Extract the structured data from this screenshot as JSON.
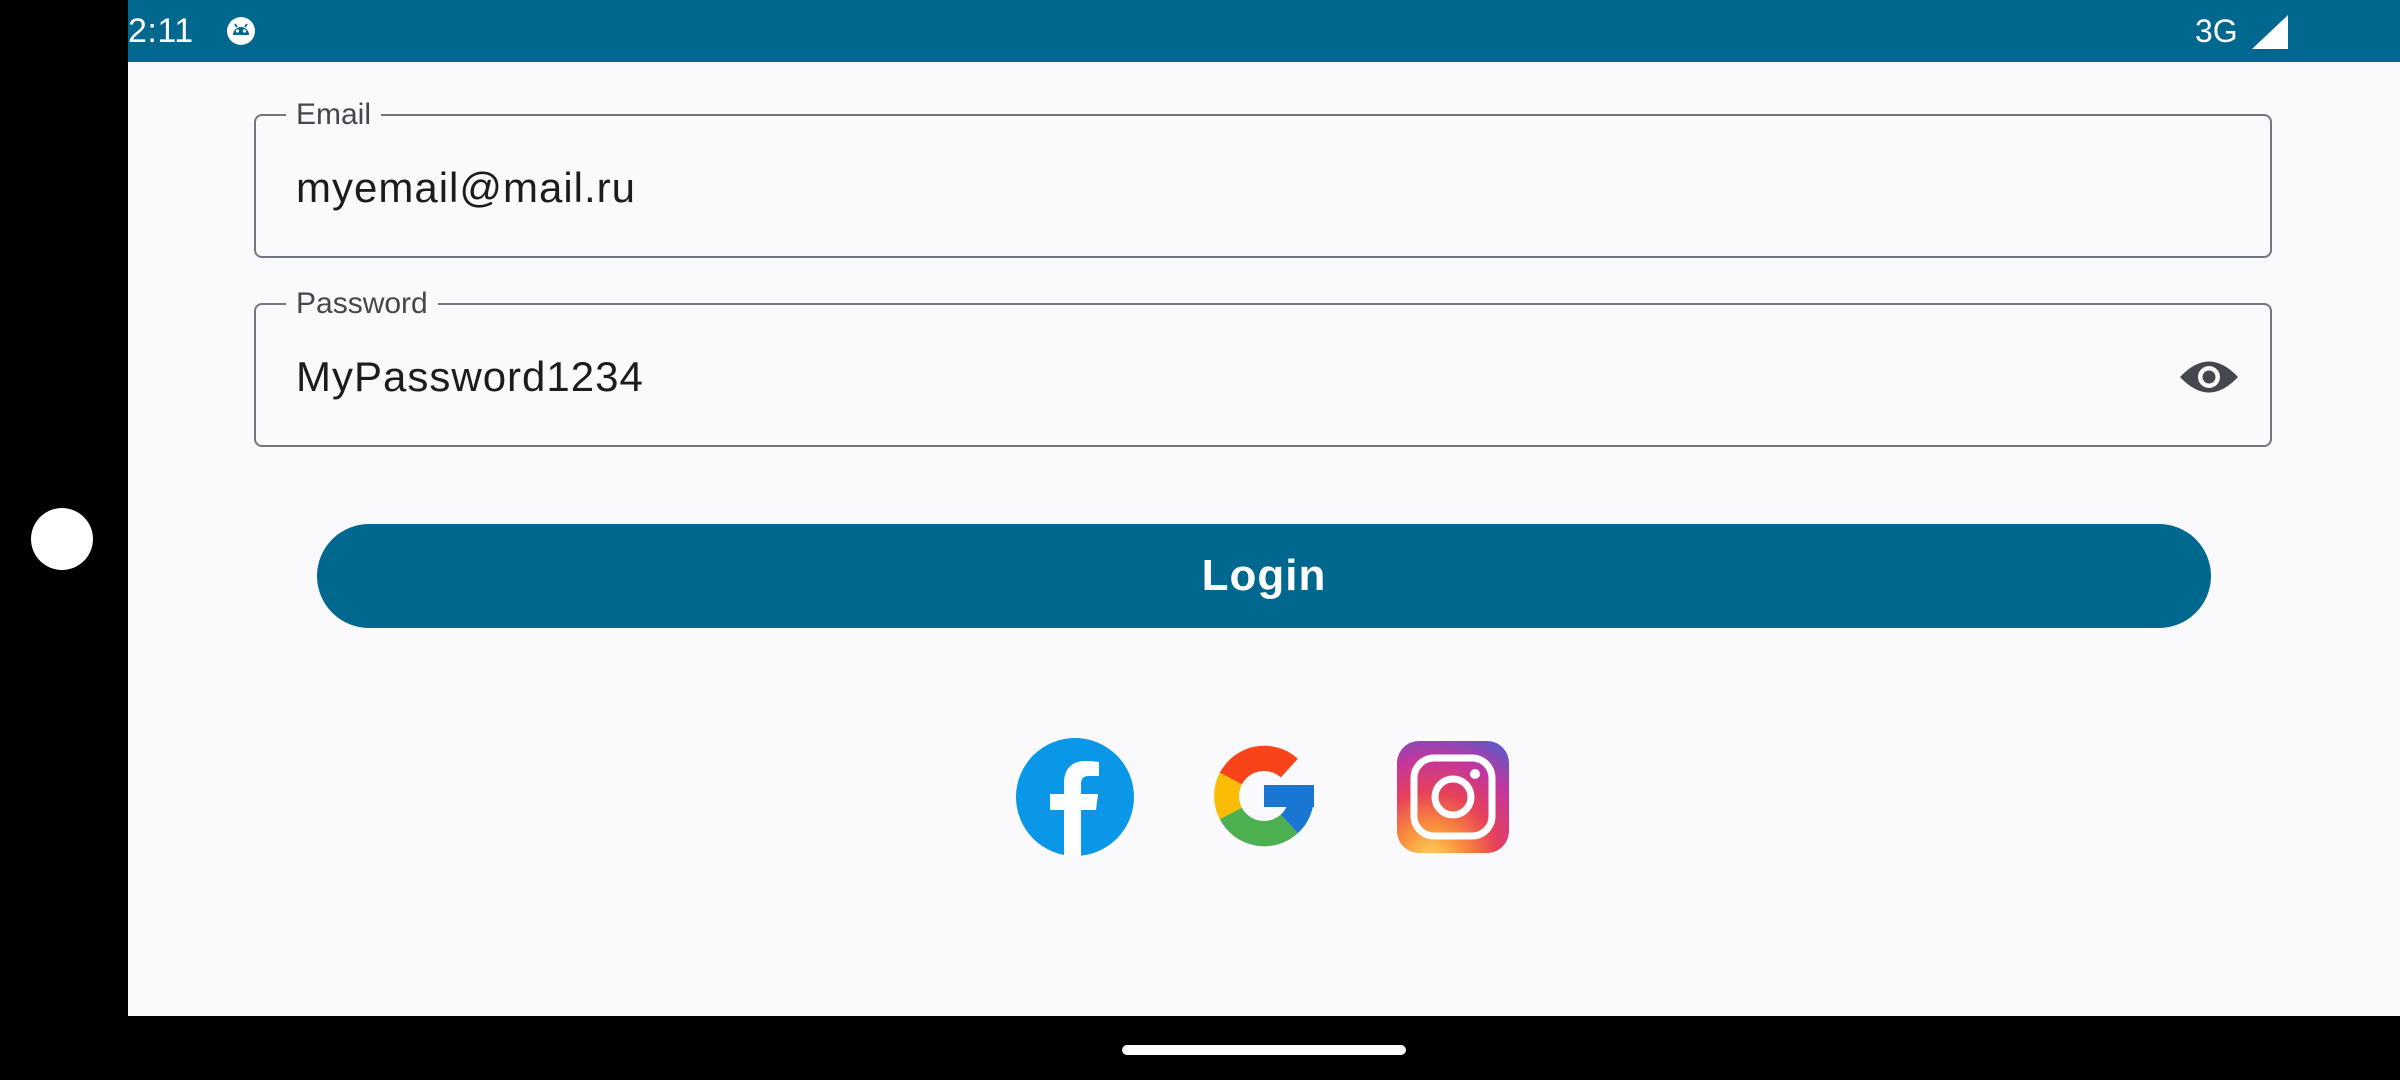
{
  "status_bar": {
    "time": "2:11",
    "network": "3G",
    "app_icon": "android-debug-icon",
    "signal_icon": "signal-strength-icon",
    "background_color": "#00678f"
  },
  "form": {
    "email": {
      "label": "Email",
      "value": "myemail@mail.ru"
    },
    "password": {
      "label": "Password",
      "value": "MyPassword1234",
      "toggle_icon": "eye-icon"
    },
    "login_label": "Login"
  },
  "social_login": {
    "providers": [
      "facebook-icon",
      "google-icon",
      "instagram-icon"
    ]
  },
  "colors": {
    "primary": "#00678f",
    "background": "#fafafc",
    "outline": "#74777f"
  }
}
